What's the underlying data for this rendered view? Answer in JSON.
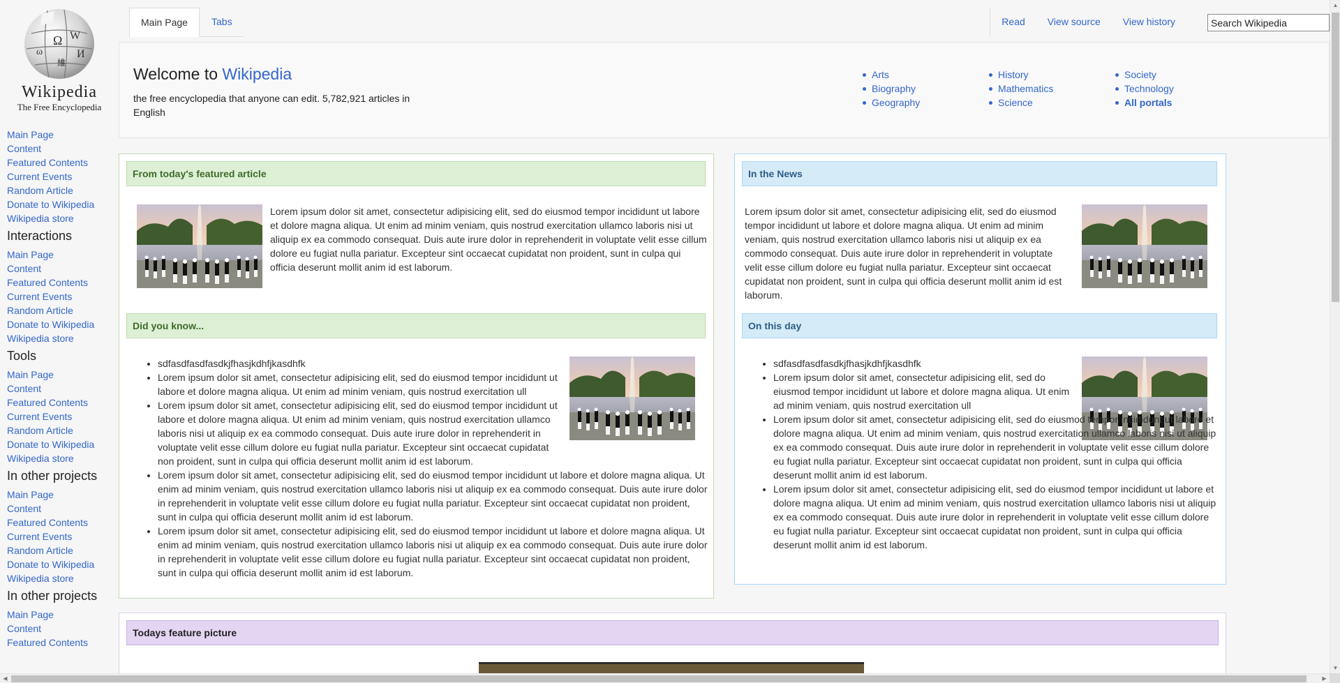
{
  "sidebar": {
    "logo": {
      "wordmark": "Wikipedia",
      "tagline": "The Free Encyclopedia"
    },
    "nav_links": [
      "Main Page",
      "Content",
      "Featured Contents",
      "Current Events",
      "Random Article",
      "Donate to Wikipedia",
      "Wikipedia store"
    ],
    "sections": [
      {
        "title": "Interactions",
        "links": [
          "Main Page",
          "Content",
          "Featured Contents",
          "Current Events",
          "Random Article",
          "Donate to Wikipedia",
          "Wikipedia store"
        ]
      },
      {
        "title": "Tools",
        "links": [
          "Main Page",
          "Content",
          "Featured Contents",
          "Current Events",
          "Random Article",
          "Donate to Wikipedia",
          "Wikipedia store"
        ]
      },
      {
        "title": "In other projects",
        "links": [
          "Main Page",
          "Content",
          "Featured Contents",
          "Current Events",
          "Random Article",
          "Donate to Wikipedia",
          "Wikipedia store"
        ]
      },
      {
        "title": "In other projects",
        "links": [
          "Main Page",
          "Content",
          "Featured Contents"
        ]
      }
    ]
  },
  "topnav": {
    "tabs": [
      "Main Page",
      "Tabs"
    ],
    "actions": [
      "Read",
      "View source",
      "View history"
    ],
    "search_placeholder": "Search Wikipedia"
  },
  "welcome": {
    "title_prefix": "Welcome to",
    "title_link": "Wikipedia",
    "description": "the free encyclopedia that anyone can edit. 5,782,921 articles in English",
    "portals": [
      [
        "Arts",
        "Biography",
        "Geography"
      ],
      [
        "History",
        "Mathematics",
        "Science"
      ],
      [
        "Society",
        "Technology",
        "All portals"
      ]
    ]
  },
  "featured": {
    "heading": "From today's featured article",
    "text": "Lorem ipsum dolor sit amet, consectetur adipisicing elit, sed do eiusmod tempor incididunt ut labore et dolore magna aliqua. Ut enim ad minim veniam, quis nostrud exercitation ullamco laboris nisi ut aliquip ex ea commodo consequat. Duis aute irure dolor in reprehenderit in voluptate velit esse cillum dolore eu fugiat nulla pariatur. Excepteur sint occaecat cupidatat non proident, sunt in culpa qui officia deserunt mollit anim id est laborum."
  },
  "dyk": {
    "heading": "Did you know...",
    "items": [
      "sdfasdfasdfasdkjfhasjkdhfjkasdhfk",
      "Lorem ipsum dolor sit amet, consectetur adipisicing elit, sed do eiusmod tempor incididunt ut labore et dolore magna aliqua. Ut enim ad minim veniam, quis nostrud exercitation ull",
      "Lorem ipsum dolor sit amet, consectetur adipisicing elit, sed do eiusmod tempor incididunt ut labore et dolore magna aliqua. Ut enim ad minim veniam, quis nostrud exercitation ullamco laboris nisi ut aliquip ex ea commodo consequat. Duis aute irure dolor in reprehenderit in voluptate velit esse cillum dolore eu fugiat nulla pariatur. Excepteur sint occaecat cupidatat non proident, sunt in culpa qui officia deserunt mollit anim id est laborum.",
      "Lorem ipsum dolor sit amet, consectetur adipisicing elit, sed do eiusmod tempor incididunt ut labore et dolore magna aliqua. Ut enim ad minim veniam, quis nostrud exercitation ullamco laboris nisi ut aliquip ex ea commodo consequat. Duis aute irure dolor in reprehenderit in voluptate velit esse cillum dolore eu fugiat nulla pariatur. Excepteur sint occaecat cupidatat non proident, sunt in culpa qui officia deserunt mollit anim id est laborum.",
      "Lorem ipsum dolor sit amet, consectetur adipisicing elit, sed do eiusmod tempor incididunt ut labore et dolore magna aliqua. Ut enim ad minim veniam, quis nostrud exercitation ullamco laboris nisi ut aliquip ex ea commodo consequat. Duis aute irure dolor in reprehenderit in voluptate velit esse cillum dolore eu fugiat nulla pariatur. Excepteur sint occaecat cupidatat non proident, sunt in culpa qui officia deserunt mollit anim id est laborum."
    ]
  },
  "news": {
    "heading": "In the News",
    "text": "Lorem ipsum dolor sit amet, consectetur adipisicing elit, sed do eiusmod tempor incididunt ut labore et dolore magna aliqua. Ut enim ad minim veniam, quis nostrud exercitation ullamco laboris nisi ut aliquip ex ea commodo consequat. Duis aute irure dolor in reprehenderit in voluptate velit esse cillum dolore eu fugiat nulla pariatur. Excepteur sint occaecat cupidatat non proident, sunt in culpa qui officia deserunt mollit anim id est laborum."
  },
  "onthisday": {
    "heading": "On this day",
    "items": [
      "sdfasdfasdfasdkjfhasjkdhfjkasdhfk",
      "Lorem ipsum dolor sit amet, consectetur adipisicing elit, sed do eiusmod tempor incididunt ut labore et dolore magna aliqua. Ut enim ad minim veniam, quis nostrud exercitation ull",
      "Lorem ipsum dolor sit amet, consectetur adipisicing elit, sed do eiusmod tempor incididunt ut labore et dolore magna aliqua. Ut enim ad minim veniam, quis nostrud exercitation ullamco laboris nisi ut aliquip ex ea commodo consequat. Duis aute irure dolor in reprehenderit in voluptate velit esse cillum dolore eu fugiat nulla pariatur. Excepteur sint occaecat cupidatat non proident, sunt in culpa qui officia deserunt mollit anim id est laborum.",
      "Lorem ipsum dolor sit amet, consectetur adipisicing elit, sed do eiusmod tempor incididunt ut labore et dolore magna aliqua. Ut enim ad minim veniam, quis nostrud exercitation ullamco laboris nisi ut aliquip ex ea commodo consequat. Duis aute irure dolor in reprehenderit in voluptate velit esse cillum dolore eu fugiat nulla pariatur. Excepteur sint occaecat cupidatat non proident, sunt in culpa qui officia deserunt mollit anim id est laborum."
    ]
  },
  "feature_picture": {
    "heading": "Todays feature picture"
  }
}
